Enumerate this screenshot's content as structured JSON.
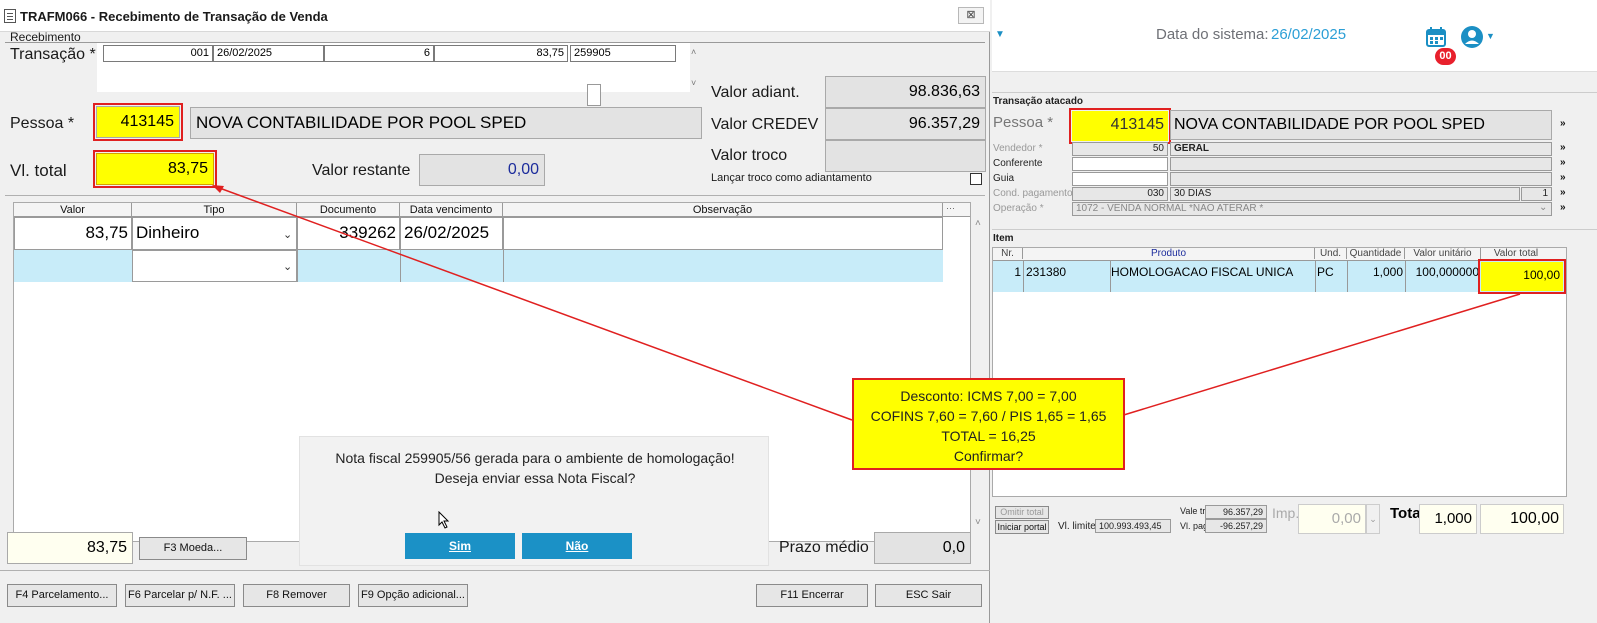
{
  "left_window": {
    "title": "TRAFM066 - Recebimento de Transação de Venda",
    "close_label": "⊠",
    "section_label": "Recebimento",
    "transacao_label": "Transação *",
    "transacao_cells": [
      "001",
      "26/02/2025",
      "6",
      "83,75",
      "259905"
    ],
    "pessoa_label": "Pessoa *",
    "pessoa_code": "413145",
    "pessoa_name": "NOVA CONTABILIDADE POR POOL SPED",
    "vl_total_label": "Vl. total",
    "vl_total_value": "83,75",
    "valor_restante_label": "Valor restante",
    "valor_restante_value": "0,00",
    "valor_adiant_label": "Valor adiant.",
    "valor_adiant_value": "98.836,63",
    "valor_credev_label": "Valor CREDEV",
    "valor_credev_value": "96.357,29",
    "valor_troco_label": "Valor troco",
    "valor_troco_value": "",
    "lancar_troco_label": "Lançar troco como adiantamento",
    "grid": {
      "headers": [
        "Valor",
        "Tipo",
        "Documento",
        "Data vencimento",
        "Observação"
      ],
      "rows": [
        {
          "valor": "83,75",
          "tipo": "Dinheiro",
          "documento": "339262",
          "data": "26/02/2025",
          "obs": ""
        }
      ]
    },
    "footer_total": "83,75",
    "f3_label": "F3 Moeda...",
    "prazo_medio_label": "Prazo médio",
    "prazo_medio_value": "0,0",
    "buttons": {
      "f4": "F4 Parcelamento...",
      "f6": "F6 Parcelar p/ N.F. ...",
      "f8": "F8 Remover",
      "f9": "F9 Opção adicional...",
      "f11": "F11 Encerrar",
      "esc": "ESC Sair"
    }
  },
  "dialog": {
    "line1": "Nota fiscal 259905/56 gerada para o ambiente de homologação!",
    "line2": "Deseja enviar essa Nota Fiscal?",
    "yes": "Sim",
    "no": "Não"
  },
  "right_window": {
    "system_date_label": "Data do sistema:",
    "system_date_value": "26/02/2025",
    "calendar_badge": "00",
    "transacao_atacado_label": "Transação atacado",
    "pessoa_label": "Pessoa *",
    "pessoa_code": "413145",
    "pessoa_name": "NOVA CONTABILIDADE POR POOL SPED",
    "vendedor_label": "Vendedor *",
    "vendedor_code": "50",
    "vendedor_name": "GERAL",
    "conferente_label": "Conferente",
    "guia_label": "Guia",
    "cond_pag_label": "Cond. pagamento *",
    "cond_pag_code": "030",
    "cond_pag_name": "30 DIAS",
    "cond_pag_num": "1",
    "operacao_label": "Operação *",
    "operacao_value": "1072 - VENDA NORMAL  *NAO ATERAR *",
    "item_label": "Item",
    "item_headers": [
      "Nr.",
      "Produto",
      "Und.",
      "Quantidade",
      "Valor unitário",
      "Valor total"
    ],
    "item_row": {
      "nr": "1",
      "code": "231380",
      "produto": "HOMOLOGACAO FISCAL UNICA",
      "und": "PC",
      "qtd": "1,000",
      "vunit": "100,000000",
      "vtotal": "100,00"
    },
    "omitir_total": "Omitir total",
    "iniciar_portal": "Iniciar portal",
    "vl_limite_label": "Vl. limite",
    "vl_limite_value": "100.993.493,45",
    "vale_troca_label": "Vale troca",
    "vale_troca_value": "96.357,29",
    "vl_pagar_label": "Vl. pagar",
    "vl_pagar_value": "-96.257,29",
    "imp_label": "Imp.",
    "imp_value": "0,00",
    "total_label": "Total",
    "total_qty": "1,000",
    "total_value": "100,00"
  },
  "note": {
    "line1": "Desconto: ICMS 7,00 = 7,00",
    "line2": "COFINS 7,60 = 7,60 / PIS 1,65 = 1,65",
    "line3": "TOTAL = 16,25",
    "line4": "Confirmar?"
  }
}
